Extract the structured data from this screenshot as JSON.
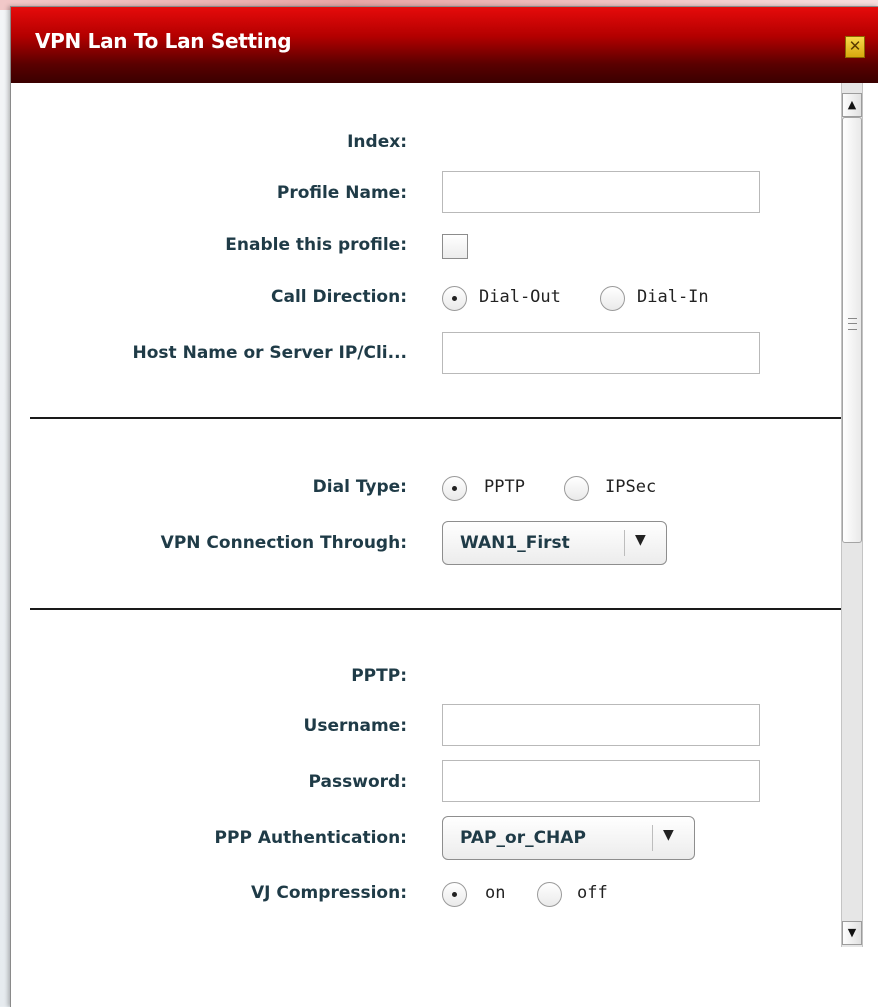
{
  "dialog": {
    "title": "VPN Lan To Lan Setting",
    "close_icon": "close-icon"
  },
  "form": {
    "index_label": "Index:",
    "profile_name_label": "Profile Name:",
    "profile_name_value": "",
    "enable_label": "Enable this profile:",
    "enable_checked": false,
    "call_direction_label": "Call Direction:",
    "call_direction_options": [
      "Dial-Out",
      "Dial-In"
    ],
    "call_direction_selected": "Dial-Out",
    "host_label": "Host Name or Server IP/Cli...",
    "host_value": "",
    "dial_type_label": "Dial Type:",
    "dial_type_options": [
      "PPTP",
      "IPSec"
    ],
    "dial_type_selected": "PPTP",
    "vpn_through_label": "VPN Connection Through:",
    "vpn_through_value": "WAN1_First",
    "pptp_label": "PPTP:",
    "username_label": "Username:",
    "username_value": "",
    "password_label": "Password:",
    "password_value": "",
    "ppp_auth_label": "PPP Authentication:",
    "ppp_auth_value": "PAP_or_CHAP",
    "vj_label": "VJ Compression:",
    "vj_options": [
      "on",
      "off"
    ],
    "vj_selected": "on"
  },
  "scrollbar": {
    "up_arrow": "▲",
    "down_arrow": "▼"
  },
  "colors": {
    "title_bar": "#b40000",
    "label_text": "#1f3b47",
    "close_button": "#f0c830"
  }
}
